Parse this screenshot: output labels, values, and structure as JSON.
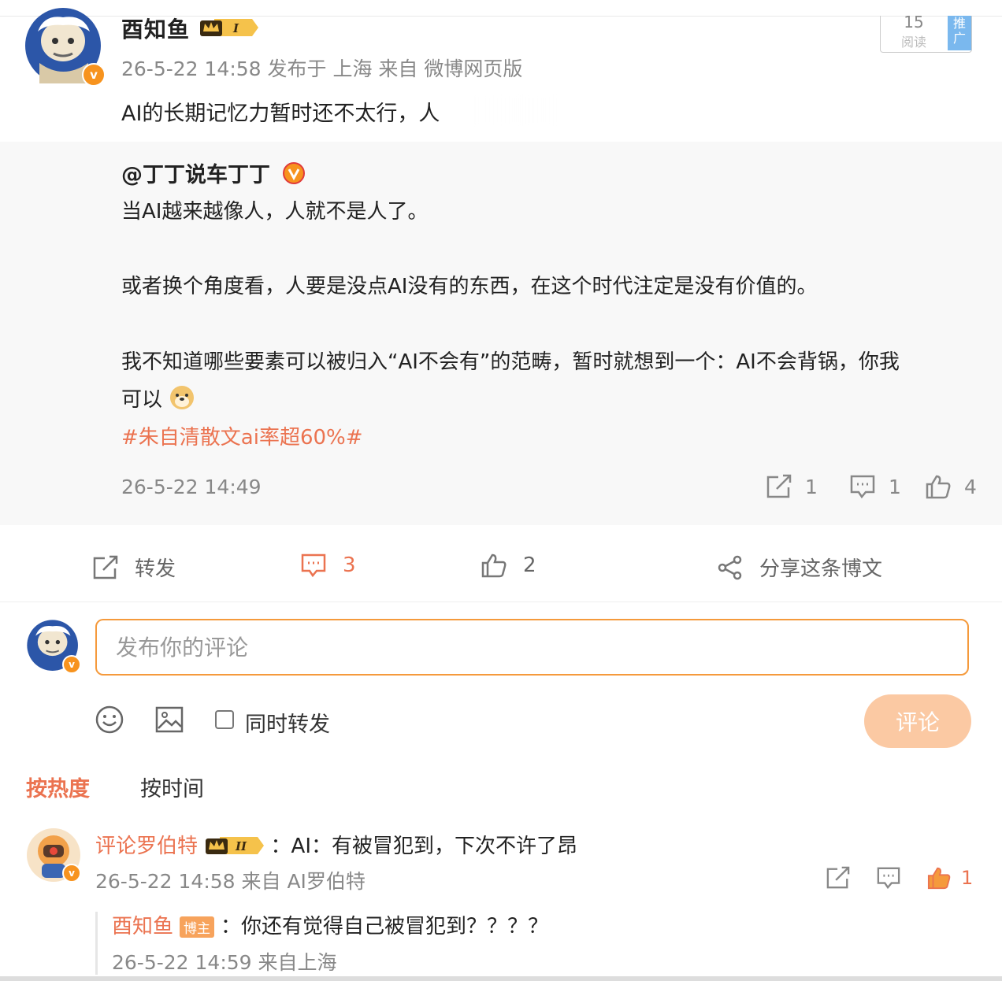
{
  "post": {
    "author": "酉知鱼",
    "level_badge": "I",
    "meta": "26-5-22 14:58 发布于 上海 来自 微博网页版",
    "text": "AI的长期记忆力暂时还不太行，人",
    "read_count": "15",
    "read_label": "阅读",
    "promote_label": "推广"
  },
  "quoted": {
    "author": "@丁丁说车丁丁",
    "lines": [
      "当AI越来越像人，人就不是人了。",
      "或者换个角度看，人要是没点AI没有的东西，在这个时代注定是没有价值的。",
      "我不知道哪些要素可以被归入“AI不会有”的范畴，暂时就想到一个：AI不会背锅，你我",
      "可以"
    ],
    "hashtag": "#朱自清散文ai率超60%#",
    "time": "26-5-22 14:49",
    "repost_count": "1",
    "comment_count": "1",
    "like_count": "4"
  },
  "actions": {
    "repost_label": "转发",
    "comment_count": "3",
    "like_count": "2",
    "share_label": "分享这条博文"
  },
  "compose": {
    "placeholder": "发布你的评论",
    "also_repost_label": "同时转发",
    "submit_label": "评论"
  },
  "sort": {
    "hot_label": "按热度",
    "time_label": "按时间"
  },
  "comments": [
    {
      "author": "评论罗伯特",
      "level_badge": "II",
      "text": "：AI：有被冒犯到，下次不许了昂",
      "meta": "26-5-22 14:58 来自 AI罗伯特",
      "like_count": "1",
      "reply": {
        "author": "酉知鱼",
        "badge": "博主",
        "text": "：你还有觉得自己被冒犯到？？？？",
        "meta": "26-5-22 14:59 来自上海"
      }
    }
  ],
  "colors": {
    "accent": "#eb7350",
    "input_border": "#f59a3c",
    "submit_disabled": "#fbc9a3",
    "quote_bg": "#f8f8f8",
    "verified_badge": "#f7931e"
  }
}
